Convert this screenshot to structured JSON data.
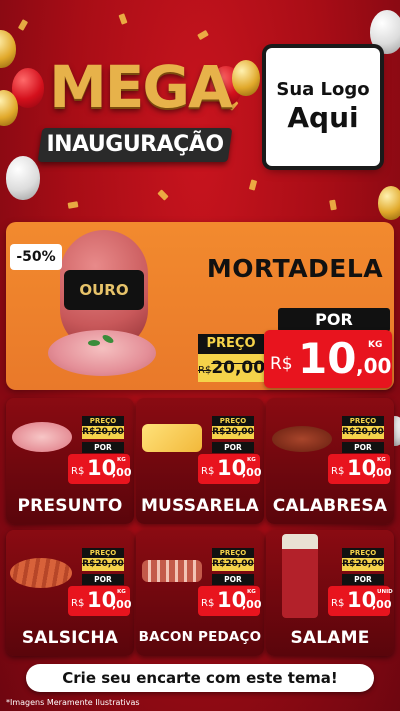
{
  "header": {
    "title_top": "MEGA",
    "title_bottom": "INAUGURAÇÃO",
    "logo_line1": "Sua Logo",
    "logo_line2": "Aqui"
  },
  "hero": {
    "discount_badge": "-50%",
    "product_name": "MORTADELA",
    "package_label": "OURO",
    "preco_label": "PREÇO",
    "old_prefix": "R$",
    "old_price": "20,00",
    "por_label": "POR",
    "currency": "R$",
    "price_int": "10",
    "price_dec": ",00",
    "unit": "KG"
  },
  "cards": [
    {
      "name": "PRESUNTO",
      "preco_label": "PREÇO",
      "old_price": "R$20,00",
      "por_label": "POR",
      "currency": "R$",
      "price_int": "10",
      "price_dec": ",00",
      "unit": "KG"
    },
    {
      "name": "MUSSARELA",
      "preco_label": "PREÇO",
      "old_price": "R$20,00",
      "por_label": "POR",
      "currency": "R$",
      "price_int": "10",
      "price_dec": ",00",
      "unit": "KG"
    },
    {
      "name": "CALABRESA",
      "preco_label": "PREÇO",
      "old_price": "R$20,00",
      "por_label": "POR",
      "currency": "R$",
      "price_int": "10",
      "price_dec": ",00",
      "unit": "KG"
    },
    {
      "name": "SALSICHA",
      "preco_label": "PREÇO",
      "old_price": "R$20,00",
      "por_label": "POR",
      "currency": "R$",
      "price_int": "10",
      "price_dec": ",00",
      "unit": "KG"
    },
    {
      "name": "BACON PEDAÇO",
      "preco_label": "PREÇO",
      "old_price": "R$20,00",
      "por_label": "POR",
      "currency": "R$",
      "price_int": "10",
      "price_dec": ",00",
      "unit": "KG"
    },
    {
      "name": "SALAME",
      "preco_label": "PREÇO",
      "old_price": "R$20,00",
      "por_label": "POR",
      "currency": "R$",
      "price_int": "10",
      "price_dec": ",00",
      "unit": "UNID"
    }
  ],
  "footer": {
    "cta": "Crie seu encarte com este tema!",
    "disclaimer": "*Imagens Meramente Ilustrativas"
  },
  "colors": {
    "background": "#a80d16",
    "accent_red": "#e8141e",
    "gold": "#f5d34a",
    "hero_orange": "#f28a2e"
  },
  "icons": [
    "balloon-icon",
    "confetti-icon",
    "product-image"
  ]
}
